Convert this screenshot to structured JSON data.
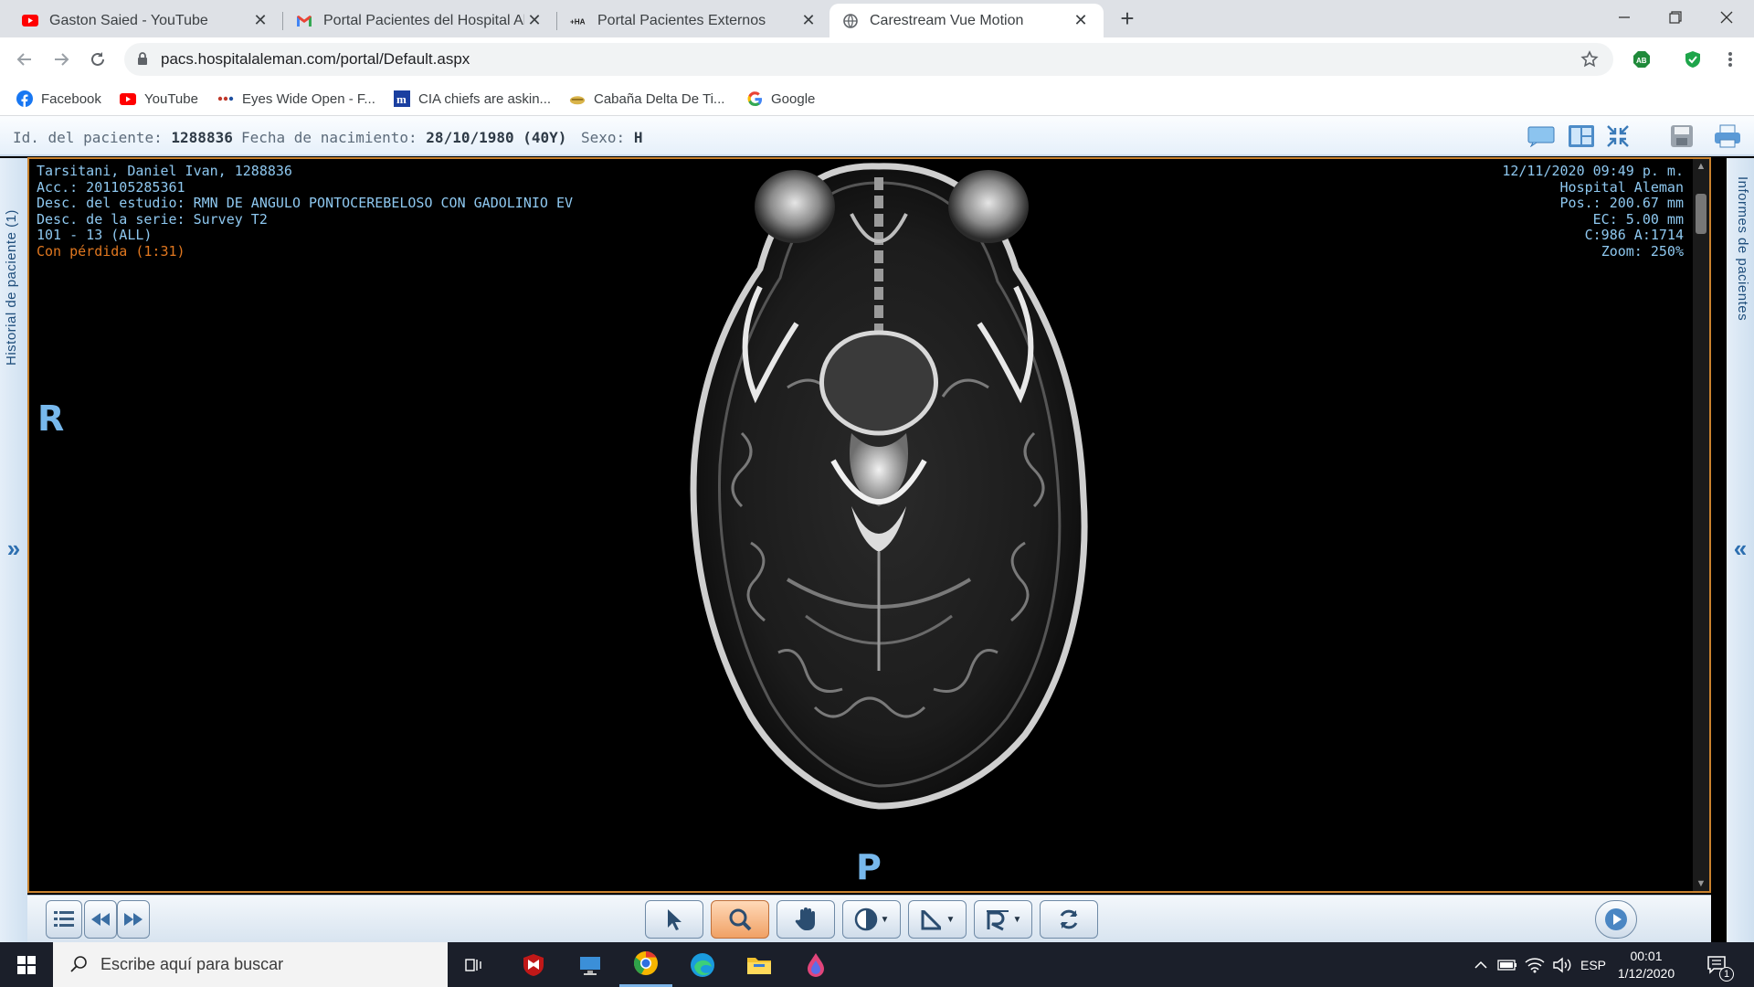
{
  "browser": {
    "tabs": [
      {
        "title": "Gaston Saied - YouTube",
        "icon": "youtube-icon",
        "active": false
      },
      {
        "title": "Portal Pacientes del Hospital Aleman",
        "icon": "gmail-icon",
        "active": false
      },
      {
        "title": "Portal Pacientes Externos",
        "icon": "hospital-aleman-icon",
        "active": false
      },
      {
        "title": "Carestream Vue Motion",
        "icon": "globe-icon",
        "active": true
      }
    ],
    "url": "pacs.hospitalaleman.com/portal/Default.aspx",
    "extensions": [
      "adblock-icon",
      "shield-check-icon"
    ],
    "bookmarks": [
      {
        "label": "Facebook",
        "icon": "facebook-icon"
      },
      {
        "label": "YouTube",
        "icon": "youtube-icon"
      },
      {
        "label": "Eyes Wide Open - F...",
        "icon": "dots-icon"
      },
      {
        "label": "CIA chiefs are askin...",
        "icon": "m-icon"
      },
      {
        "label": "Cabaña Delta De Ti...",
        "icon": "cabin-icon"
      },
      {
        "label": "Google",
        "icon": "google-icon"
      }
    ]
  },
  "header": {
    "patient_id_label": "Id. del paciente:",
    "patient_id": "1288836",
    "dob_label": "Fecha de nacimiento:",
    "dob": "28/10/1980 (40Y)",
    "sex_label": "Sexo:",
    "sex": "H"
  },
  "side": {
    "left_label": "Historial de paciente (1)",
    "right_label": "Informes de pacientes",
    "left_chevron": "»",
    "right_chevron": "«"
  },
  "overlay": {
    "tl": [
      "Tarsitani, Daniel Ivan, 1288836",
      "Acc.: 201105285361",
      "Desc. del estudio: RMN DE ANGULO PONTOCEREBELOSO CON GADOLINIO EV",
      "Desc. de la serie: Survey T2",
      "101 - 13 (ALL)"
    ],
    "lossy": "Con pérdida (1:31)",
    "tr": [
      "12/11/2020 09:49 p. m.",
      "Hospital Aleman",
      "Pos.: 200.67 mm",
      "EC: 5.00 mm",
      "C:986 A:1714",
      "Zoom: 250%"
    ],
    "orient_left": "R",
    "orient_bottom": "P"
  },
  "toolbar": {
    "tools": [
      "pointer-tool",
      "zoom-tool",
      "pan-tool",
      "window-level-tool",
      "measure-tool",
      "annotation-tool",
      "rotate-tool"
    ],
    "selected": "zoom-tool"
  },
  "taskbar": {
    "search_placeholder": "Escribe aquí para buscar",
    "apps": [
      "task-view-icon",
      "mcafee-icon",
      "remote-desktop-icon",
      "chrome-icon",
      "edge-icon",
      "file-explorer-icon",
      "paint-icon"
    ],
    "language": "ESP",
    "time": "00:01",
    "date": "1/12/2020",
    "notifications": "1"
  },
  "colors": {
    "overlay_text": "#8ec8f0",
    "lossy_text": "#e0771f",
    "viewport_border": "#c9822e",
    "selected_tool": "#f0a165"
  }
}
